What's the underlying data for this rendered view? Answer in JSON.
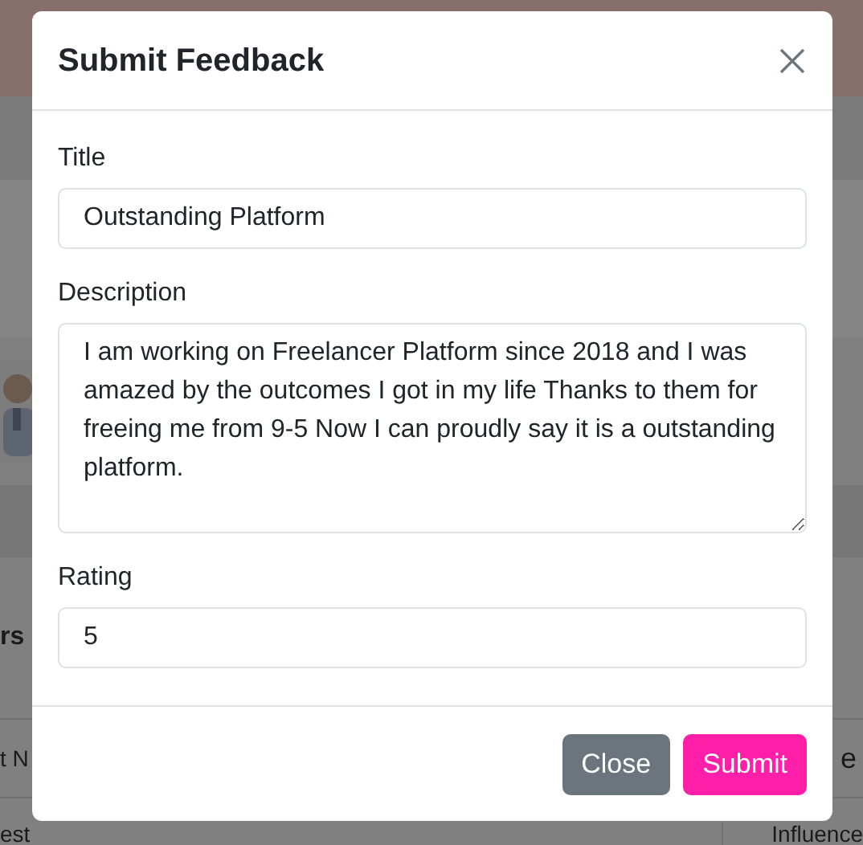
{
  "background": {
    "section_heading": "rs",
    "table": {
      "columns": [
        "t N",
        "e"
      ],
      "rows": [
        [
          "est",
          "Influence"
        ]
      ]
    }
  },
  "modal": {
    "title": "Submit Feedback",
    "fields": [
      {
        "kind": "input",
        "label": "Title",
        "value": "Outstanding Platform"
      },
      {
        "kind": "textarea",
        "label": "Description",
        "value": "I am working on Freelancer Platform since 2018 and I was amazed by the outcomes I got in my life Thanks to them for freeing me from 9-5 Now I can proudly say it is a outstanding platform."
      },
      {
        "kind": "input",
        "label": "Rating",
        "value": "5"
      }
    ],
    "buttons": [
      {
        "kind": "secondary",
        "label": "Close"
      },
      {
        "kind": "primary",
        "label": "Submit"
      }
    ]
  }
}
